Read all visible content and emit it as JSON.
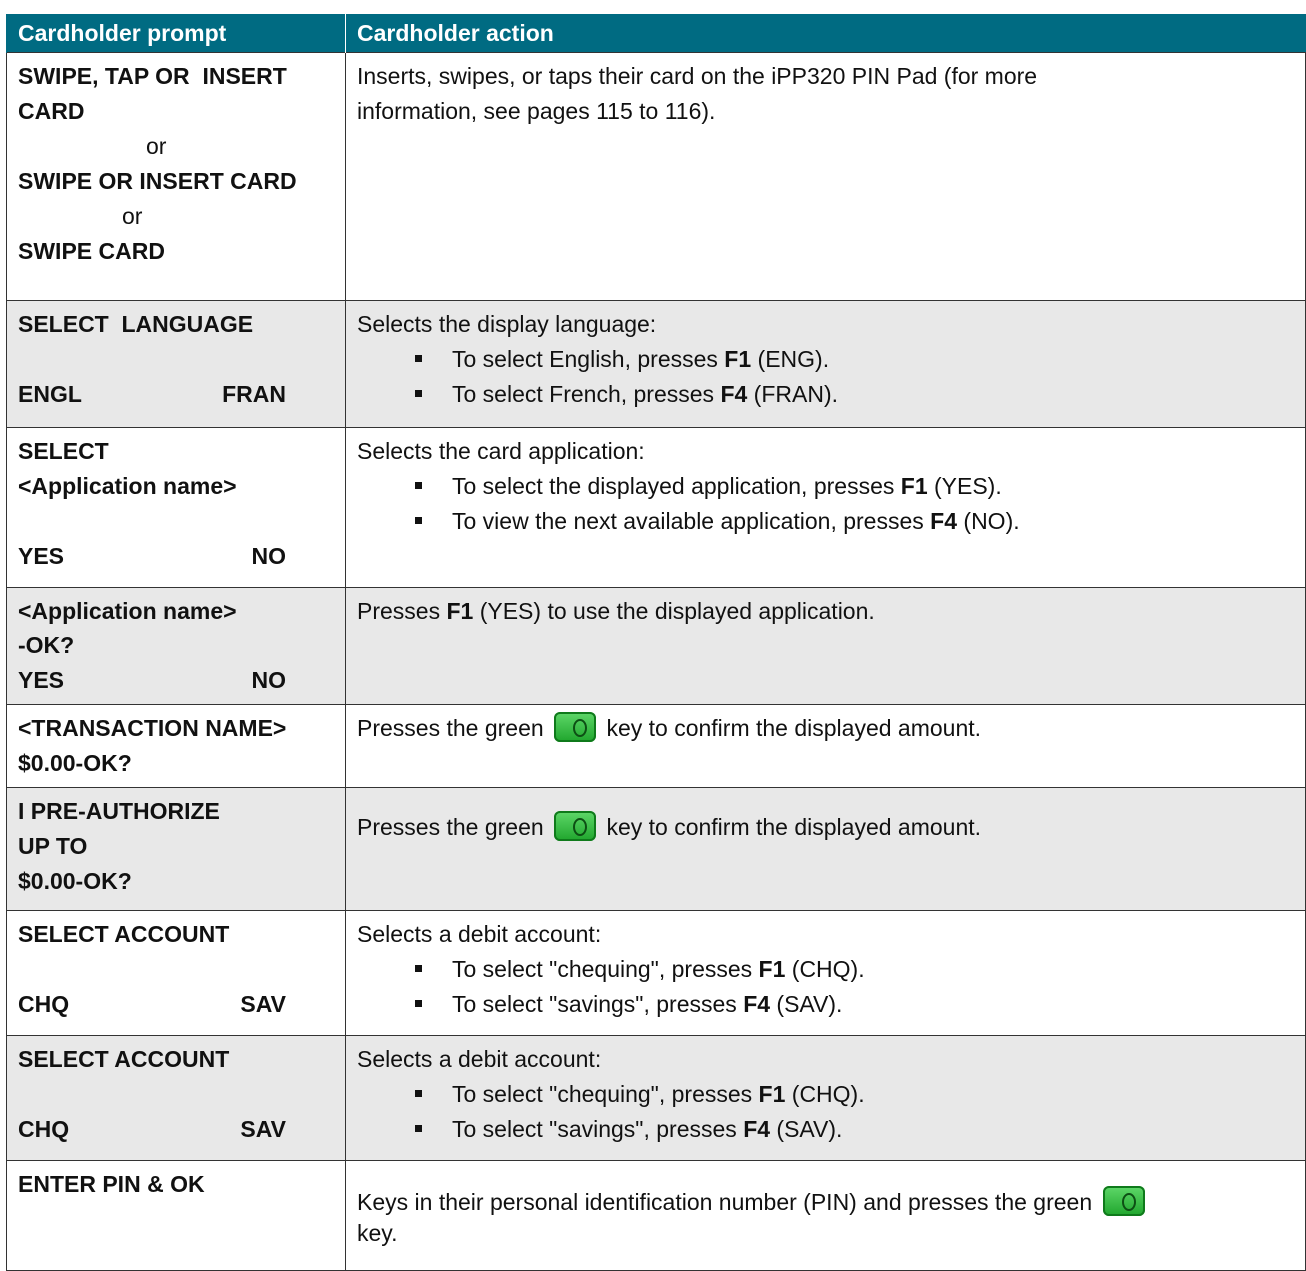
{
  "header": {
    "col_prompt": "Cardholder prompt",
    "col_action": "Cardholder action"
  },
  "icons": {
    "green_key": "green-ok-key-icon",
    "bullet": "square-bullet-icon"
  },
  "colors": {
    "header_bg": "#006b82",
    "shaded_row": "#e8e8e8",
    "key_green": "#2cb83a"
  },
  "rows": [
    {
      "prompt": [
        "SWIPE, TAP OR  INSERT",
        "CARD",
        "or",
        "SWIPE OR INSERT CARD",
        "or",
        "SWIPE CARD"
      ],
      "action": [
        "Inserts, swipes, or taps their card on the iPP320 PIN Pad (for more",
        "information, see pages 115 to 116)."
      ]
    },
    {
      "prompt_title": "SELECT  LANGUAGE",
      "prompt_left": "ENGL",
      "prompt_right": "FRAN",
      "intro": "Selects the display language:",
      "bullets": [
        {
          "pre": "To select English, presses ",
          "key": "F1",
          "post": " (ENG)."
        },
        {
          "pre": "To select French, presses ",
          "key": "F4",
          "post": " (FRAN)."
        }
      ]
    },
    {
      "prompt_lines": [
        "SELECT",
        "<Application name>"
      ],
      "prompt_left": "YES",
      "prompt_right": "NO",
      "intro": "Selects the card application:",
      "bullets": [
        {
          "pre": "To select the displayed application, presses ",
          "key": "F1",
          "post": " (YES)."
        },
        {
          "pre": "To view the next available application, presses ",
          "key": "F4",
          "post": " (NO)."
        }
      ]
    },
    {
      "prompt_lines": [
        "<Application name>",
        "-OK?"
      ],
      "prompt_left": "YES",
      "prompt_right": "NO",
      "pre": "Presses ",
      "key": "F1",
      "post": " (YES) to use the displayed application."
    },
    {
      "prompt_lines": [
        "<TRANSACTION NAME>",
        "$0.00-OK?"
      ],
      "pre": "Presses the green ",
      "post": " key to confirm the displayed amount."
    },
    {
      "prompt_lines": [
        "I PRE-AUTHORIZE",
        "UP TO",
        "$0.00-OK?"
      ],
      "pre": "Presses the green ",
      "post": " key to confirm the displayed amount."
    },
    {
      "prompt_title": "SELECT ACCOUNT",
      "prompt_left": "CHQ",
      "prompt_right": "SAV",
      "intro": "Selects a debit account:",
      "bullets": [
        {
          "pre": "To select \"chequing\", presses ",
          "key": "F1",
          "post": " (CHQ)."
        },
        {
          "pre": "To select \"savings\", presses ",
          "key": "F4",
          "post": " (SAV)."
        }
      ]
    },
    {
      "prompt_title": "SELECT ACCOUNT",
      "prompt_left": "CHQ",
      "prompt_right": "SAV",
      "intro": "Selects a debit account:",
      "bullets": [
        {
          "pre": "To select \"chequing\", presses ",
          "key": "F1",
          "post": " (CHQ)."
        },
        {
          "pre": "To select \"savings\", presses ",
          "key": "F4",
          "post": " (SAV)."
        }
      ]
    },
    {
      "prompt_title": "ENTER PIN & OK",
      "pre": "Keys in their personal identification number (PIN) and presses the green ",
      "post": "key."
    }
  ]
}
